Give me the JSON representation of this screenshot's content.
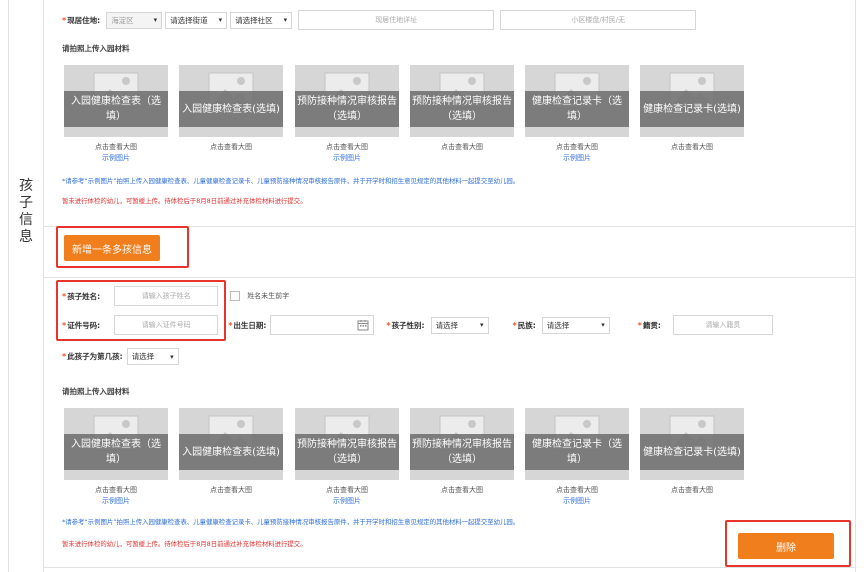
{
  "residence": {
    "label": "现居住地:",
    "district": "海淀区",
    "street_placeholder": "请选择街道",
    "community_placeholder": "请选择社区",
    "address_placeholder": "现居住地详址",
    "building_placeholder": "小区楼盘/村民/无"
  },
  "upload_title": "请拍照上传入园材料",
  "upload_items": [
    {
      "text": "入园健康检查表（选填）",
      "view": "点击查看大图",
      "example": "示例图片"
    },
    {
      "text": "入园健康检查表(选填)",
      "view": "点击查看大图",
      "example": ""
    },
    {
      "text": "预防接种情况审核报告（选填）",
      "view": "点击查看大图",
      "example": "示例图片"
    },
    {
      "text": "预防接种情况审核报告（选填）",
      "view": "点击查看大图",
      "example": ""
    },
    {
      "text": "健康检查记录卡（选填）",
      "view": "点击查看大图",
      "example": "示例图片"
    },
    {
      "text": "健康检查记录卡(选填)",
      "view": "点击查看大图",
      "example": ""
    }
  ],
  "notes": {
    "blue": "*请参考“示例图片”拍照上传入园健康检查表、儿童健康检查记录卡、儿童预防接种情况审核报告原件，并于开学时和招生意见规定的其他材料一起提交至幼儿园。",
    "red": "暂未进行体检的幼儿，可暂缓上传。待体检后于8月8日前通过补充体检材料进行提交。"
  },
  "section_label": "孩子信息",
  "add_child_button": "新增一条多孩信息",
  "child_form": {
    "name_label": "孩子姓名:",
    "name_placeholder": "请输入孩子姓名",
    "no_name_label": "姓名未生前字",
    "id_label": "证件号码:",
    "id_placeholder": "请输入证件号码",
    "birth_label": "出生日期:",
    "gender_label": "孩子性别:",
    "gender_value": "请选择",
    "ethnic_label": "民族:",
    "ethnic_value": "请选择",
    "native_label": "籍贯:",
    "native_placeholder": "请输入籍贯",
    "order_label": "此孩子为第几孩:",
    "order_value": "请选择"
  },
  "delete_button": "删除",
  "colors": {
    "accent": "#f07e1c",
    "highlight": "#e8352b",
    "link": "#2e6ed8",
    "warning": "#e03030"
  }
}
